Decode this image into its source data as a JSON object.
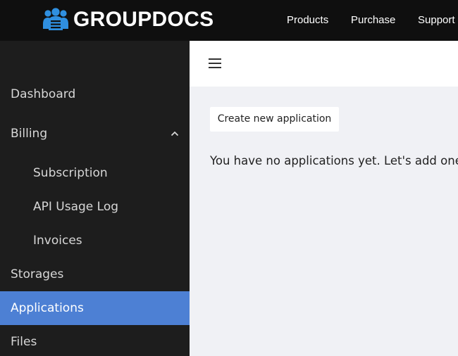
{
  "brand": {
    "name": "GROUPDOCS",
    "logo_icon": "groupdocs-people-logo-icon"
  },
  "topnav": [
    {
      "label": "Products"
    },
    {
      "label": "Purchase"
    },
    {
      "label": "Support"
    }
  ],
  "sidebar": {
    "items": [
      {
        "label": "Dashboard"
      },
      {
        "label": "Billing",
        "expanded": true,
        "icon": "chevron-up-icon"
      },
      {
        "label": "Subscription"
      },
      {
        "label": "API Usage Log"
      },
      {
        "label": "Invoices"
      },
      {
        "label": "Storages"
      },
      {
        "label": "Applications",
        "active": true
      },
      {
        "label": "Files"
      }
    ]
  },
  "header": {
    "menu_icon": "hamburger-menu-icon"
  },
  "main": {
    "create_button_label": "Create new application",
    "empty_message": "You have no applications yet. Let's add one!"
  },
  "colors": {
    "topbar_bg": "#0f0f0f",
    "sidebar_bg": "#1d1d1d",
    "active_item_bg": "#4d80d4",
    "content_bg": "#f0f1f5",
    "logo_blue": "#2f8fe0"
  }
}
